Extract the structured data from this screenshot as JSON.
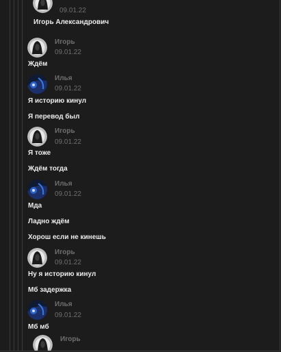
{
  "top_post": {
    "time": "09.01.22",
    "text": "Игорь Александрович"
  },
  "posts": [
    {
      "author": "Игорь",
      "avatar": "mask-avatar",
      "time": "09.01.22",
      "lines": [
        "Ждём"
      ]
    },
    {
      "author": "Илья",
      "avatar": "blue-avatar",
      "time": "09.01.22",
      "lines": [
        "Я историю кинул",
        "Я перевод был"
      ]
    },
    {
      "author": "Игорь",
      "avatar": "mask-avatar",
      "time": "09.01.22",
      "lines": [
        "Я тоже",
        "Ждём тогда"
      ]
    },
    {
      "author": "Илья",
      "avatar": "blue-avatar",
      "time": "09.01.22",
      "lines": [
        "Мда",
        "Ладно ждём",
        "Хорош если не кинешь"
      ]
    },
    {
      "author": "Игорь",
      "avatar": "mask-avatar",
      "time": "09.01.22",
      "lines": [
        "Ну я историю кинул",
        "Мб задержка"
      ]
    },
    {
      "author": "Илья",
      "avatar": "blue-avatar",
      "time": "09.01.22",
      "lines": [
        "Мб мб"
      ]
    }
  ],
  "bottom_post": {
    "author": "Игорь",
    "avatar": "mask-avatar"
  }
}
